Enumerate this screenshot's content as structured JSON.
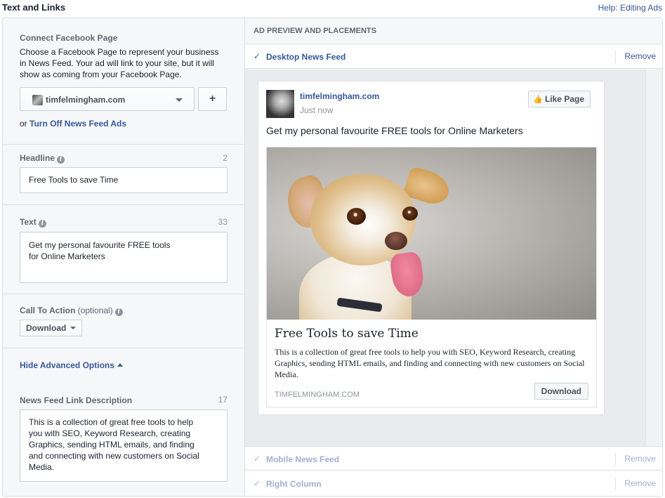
{
  "header": {
    "title": "Text and Links",
    "help_link": "Help: Editing Ads"
  },
  "left": {
    "connect_page": {
      "label": "Connect Facebook Page",
      "description": "Choose a Facebook Page to represent your business in News Feed. Your ad will link to your site, but it will show as coming from your Facebook Page.",
      "selected_page": "timfelmingham.com",
      "add_button": "+",
      "or_text": "or ",
      "turn_off_link": "Turn Off News Feed Ads"
    },
    "headline": {
      "label": "Headline",
      "count": "2",
      "value": "Free Tools to save Time"
    },
    "text": {
      "label": "Text",
      "count": "33",
      "value": "Get my personal favourite FREE tools for Online Marketers"
    },
    "cta": {
      "label": "Call To Action",
      "optional": " (optional)",
      "selected": "Download"
    },
    "advanced": {
      "toggle_label": "Hide Advanced Options"
    },
    "link_description": {
      "label": "News Feed Link Description",
      "count": "17",
      "value": "This is a collection of great free tools to help you with SEO, Keyword Research, creating Graphics, sending HTML emails, and finding and connecting with new customers on Social Media."
    }
  },
  "right": {
    "header": "AD PREVIEW AND PLACEMENTS",
    "placements": [
      {
        "name": "Desktop News Feed",
        "remove": "Remove",
        "check": "✓"
      },
      {
        "name": "Mobile News Feed",
        "remove": "Remove",
        "check": "✓"
      },
      {
        "name": "Right Column",
        "remove": "Remove",
        "check": "✓"
      }
    ],
    "preview": {
      "page_name": "timfelmingham.com",
      "time": "Just now",
      "like_button": "Like Page",
      "post_text": "Get my personal favourite FREE tools for Online Marketers",
      "ad_title": "Free Tools to save Time",
      "ad_description": "This is a collection of great free tools to help you with SEO, Keyword Research, creating Graphics, sending HTML emails, and finding and connecting with new customers on Social Media.",
      "domain": "TIMFELMINGHAM.COM",
      "cta_button": "Download"
    }
  },
  "colors": {
    "link": "#365899",
    "panel_bg": "#f6f7f9",
    "preview_bg": "#e9ebee",
    "border": "#dddfe2"
  }
}
